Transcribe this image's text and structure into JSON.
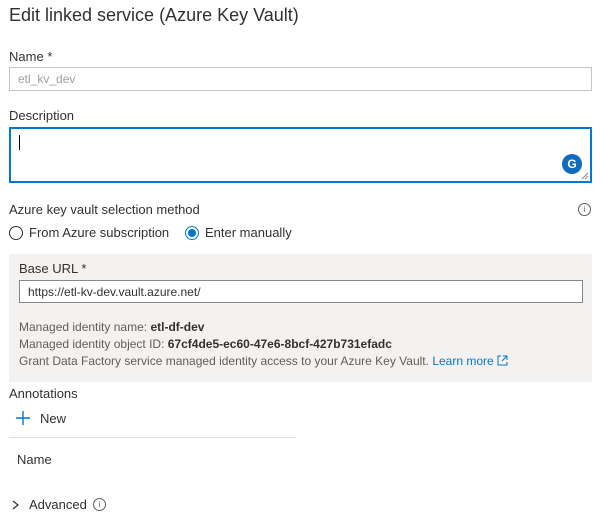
{
  "panel": {
    "title": "Edit linked service (Azure Key Vault)"
  },
  "name": {
    "label": "Name",
    "required_mark": "*",
    "placeholder": "etl_kv_dev"
  },
  "description": {
    "label": "Description",
    "value": ""
  },
  "selection_method": {
    "label": "Azure key vault selection method",
    "options": [
      {
        "label": "From Azure subscription",
        "selected": false
      },
      {
        "label": "Enter manually",
        "selected": true
      }
    ]
  },
  "base_url": {
    "label": "Base URL",
    "required_mark": "*",
    "value": "https://etl-kv-dev.vault.azure.net/"
  },
  "identity": {
    "name_label": "Managed identity name:",
    "name_value": "etl-df-dev",
    "object_id_label": "Managed identity object ID:",
    "object_id_value": "67cf4de5-ec60-47e6-8bcf-427b731efadc",
    "grant_text": "Grant Data Factory service managed identity access to your Azure Key Vault.",
    "learn_more": "Learn more"
  },
  "annotations": {
    "label": "Annotations",
    "new_label": "New",
    "column_name": "Name"
  },
  "advanced": {
    "label": "Advanced"
  },
  "colors": {
    "accent": "#0078d4",
    "panel_bg": "#f3f2f1",
    "text": "#323130",
    "muted": "#605e5c"
  }
}
